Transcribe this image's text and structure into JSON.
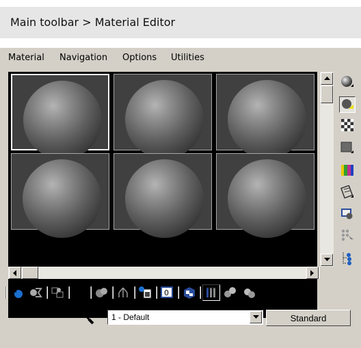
{
  "caption": {
    "text": "Main toolbar > Material Editor"
  },
  "menu": [
    "Material",
    "Navigation",
    "Options",
    "Utilities"
  ],
  "slots": [
    {
      "selected": true
    },
    {
      "selected": false
    },
    {
      "selected": false
    },
    {
      "selected": false
    },
    {
      "selected": false
    },
    {
      "selected": false
    }
  ],
  "side_icons": [
    "sample-type-sphere-icon",
    "backlight-icon",
    "background-checker-icon",
    "sample-uv-tiling-icon",
    "video-color-check-icon",
    "make-preview-icon",
    "options-icon",
    "select-by-material-icon",
    "material-map-navigator-icon"
  ],
  "bottom_toolbar_icons": [
    "get-material-icon",
    "put-material-to-scene-icon",
    "assign-material-to-selection-icon",
    "reset-map-icon",
    "make-material-copy-icon",
    "make-unique-icon",
    "put-to-library-icon",
    "material-effects-channel-icon",
    "show-map-in-viewport-icon",
    "show-end-result-icon",
    "go-to-parent-icon",
    "go-forward-to-sibling-icon"
  ],
  "material_name": {
    "value": "1 - Default"
  },
  "material_type_button": "Standard",
  "colors": {
    "window_bg": "#d4d0c8",
    "slot_bg": "#404040",
    "caption_bg": "#e6e6e6"
  }
}
